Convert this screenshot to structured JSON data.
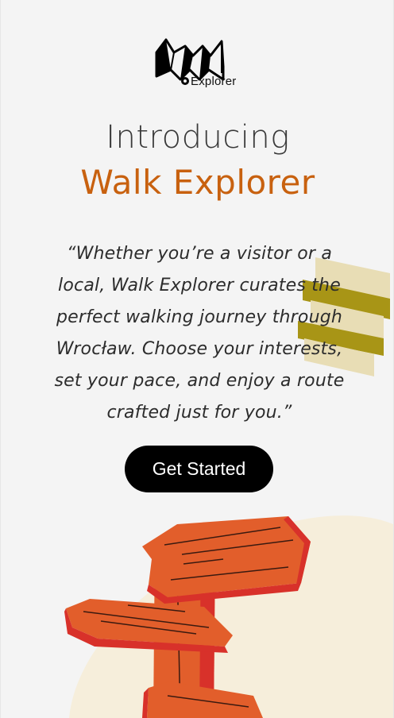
{
  "brand": {
    "logo_text": "Explorer",
    "icon": "folded-map-pin-icon"
  },
  "hero": {
    "title_line1": "Introducing",
    "title_line2": "Walk Explorer",
    "accent_color": "#c8610f",
    "quote": "“Whether you’re a visitor or a local, Walk Explorer curates the perfect walking journey through Wrocław. Choose your interests, set your pace, and enjoy a route crafted just for you.”"
  },
  "cta": {
    "label": "Get Started"
  },
  "illustration": {
    "icon": "signpost-illustration",
    "decor": "stairs-decoration"
  },
  "colors": {
    "background": "#f4f4f4",
    "signpost": "#e25e2b",
    "signpost_shadow": "#d8312a",
    "blob": "#f6eedb",
    "stairs_dark": "#a89516",
    "stairs_light": "#e8ddb5"
  }
}
